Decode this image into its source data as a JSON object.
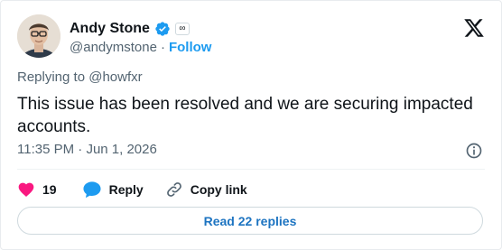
{
  "author": {
    "display_name": "Andy Stone",
    "handle": "@andymstone",
    "separator": "·",
    "follow_label": "Follow",
    "affiliation_badge": "∞",
    "verified_color": "#1d9bf0"
  },
  "tweet": {
    "replying_to_prefix": "Replying to",
    "replying_to_handle": "@howfxr",
    "text": "This issue has been resolved and we are securing impacted accounts.",
    "time": "11:35 PM",
    "separator": "·",
    "date": "Jun 1, 2026"
  },
  "actions": {
    "like_count": "19",
    "reply_label": "Reply",
    "copy_link_label": "Copy link"
  },
  "read_replies_label": "Read 22 replies",
  "colors": {
    "accent": "#1d9bf0",
    "like": "#f91880",
    "muted": "#536471"
  },
  "icons": {
    "logo": "x-logo-icon",
    "verified": "verified-badge-icon",
    "info": "info-icon",
    "like": "heart-icon",
    "reply": "speech-bubble-icon",
    "copy": "link-icon"
  }
}
